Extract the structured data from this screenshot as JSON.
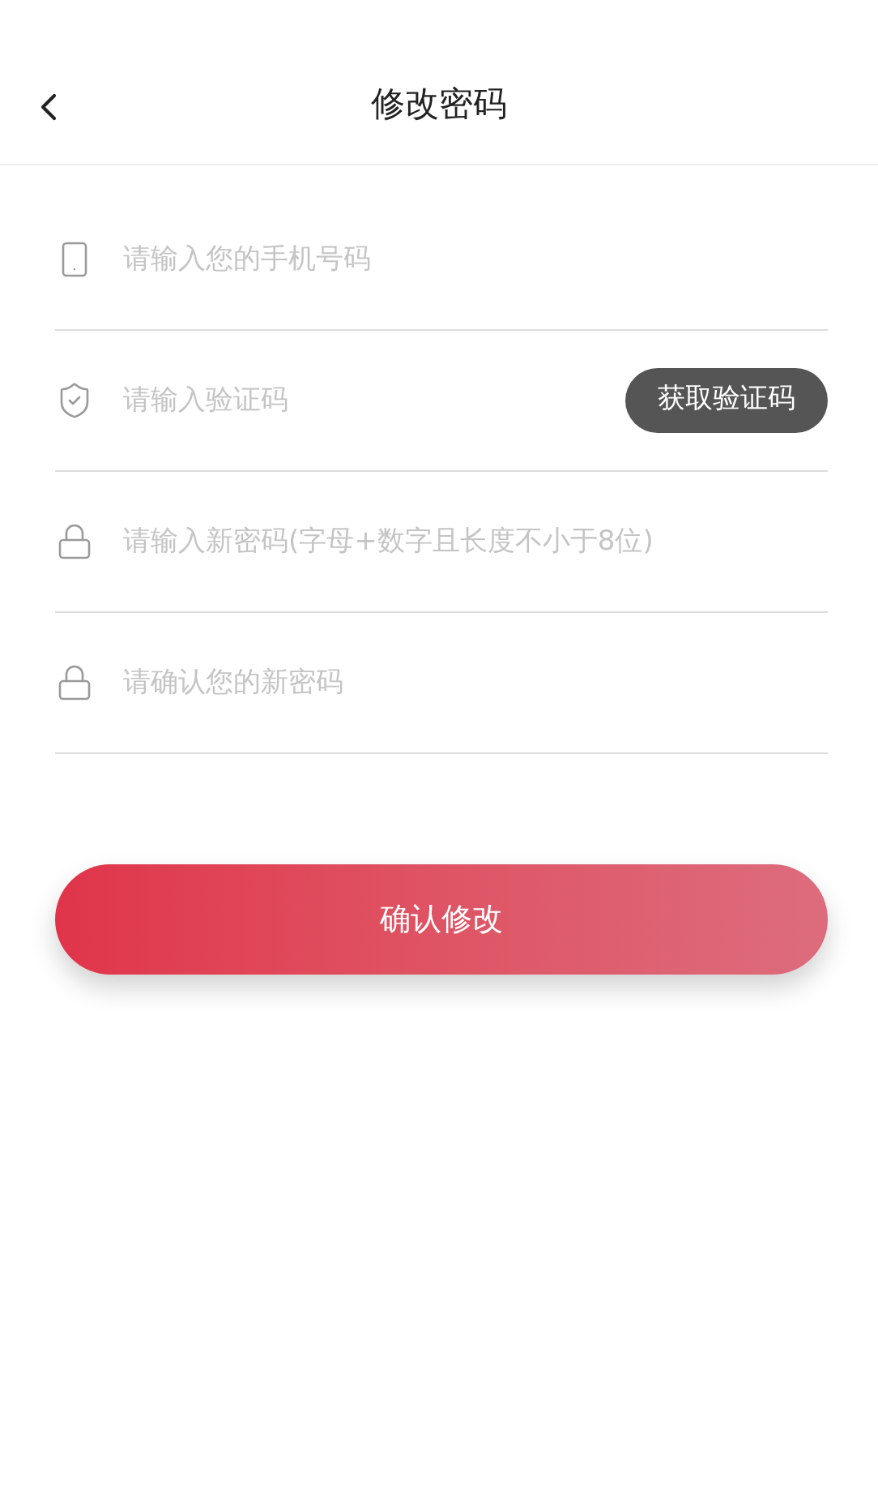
{
  "header": {
    "title": "修改密码"
  },
  "fields": [
    {
      "kind": "phone",
      "placeholder": "请输入您的手机号码"
    },
    {
      "kind": "code",
      "placeholder": "请输入验证码",
      "button": "获取验证码"
    },
    {
      "kind": "lock",
      "placeholder": "请输入新密码(字母+数字且长度不小于8位)"
    },
    {
      "kind": "lock",
      "placeholder": "请确认您的新密码"
    }
  ],
  "submit": "确认修改"
}
